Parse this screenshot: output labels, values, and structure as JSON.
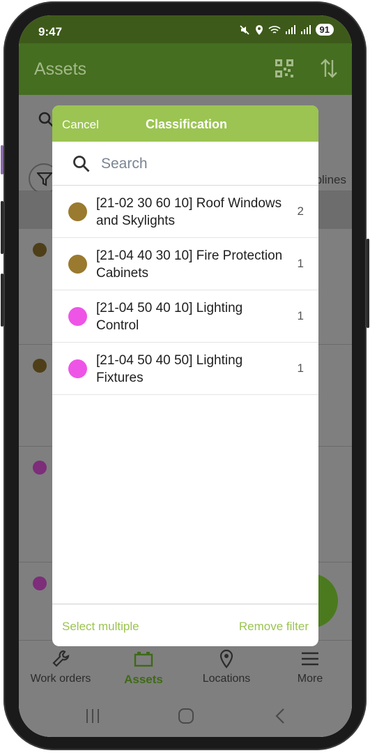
{
  "status_bar": {
    "time": "9:47",
    "battery": "91"
  },
  "app_bar": {
    "title": "Assets"
  },
  "background": {
    "filter_chip_text": "plines"
  },
  "modal": {
    "cancel_label": "Cancel",
    "title": "Classification",
    "search_placeholder": "Search",
    "items": [
      {
        "label": "[21-02 30 60 10] Roof Windows and Skylights",
        "count": "2",
        "color": "#9a7a2e"
      },
      {
        "label": "[21-04 40 30 10] Fire Protection Cabinets",
        "count": "1",
        "color": "#9a7a2e"
      },
      {
        "label": "[21-04 50 40 10] Lighting Control",
        "count": "1",
        "color": "#ee55e6"
      },
      {
        "label": "[21-04 50 40 50] Lighting Fixtures",
        "count": "1",
        "color": "#ee55e6"
      }
    ],
    "select_multiple_label": "Select multiple",
    "remove_filter_label": "Remove filter"
  },
  "bottom_nav": {
    "items": [
      {
        "label": "Work orders",
        "icon": "wrench-icon"
      },
      {
        "label": "Assets",
        "icon": "assets-icon"
      },
      {
        "label": "Locations",
        "icon": "location-pin-icon"
      },
      {
        "label": "More",
        "icon": "menu-icon"
      }
    ],
    "active_index": 1
  },
  "colors": {
    "accent": "#9bc452",
    "app_bar": "#456e20",
    "active_nav": "#3f6a17"
  }
}
